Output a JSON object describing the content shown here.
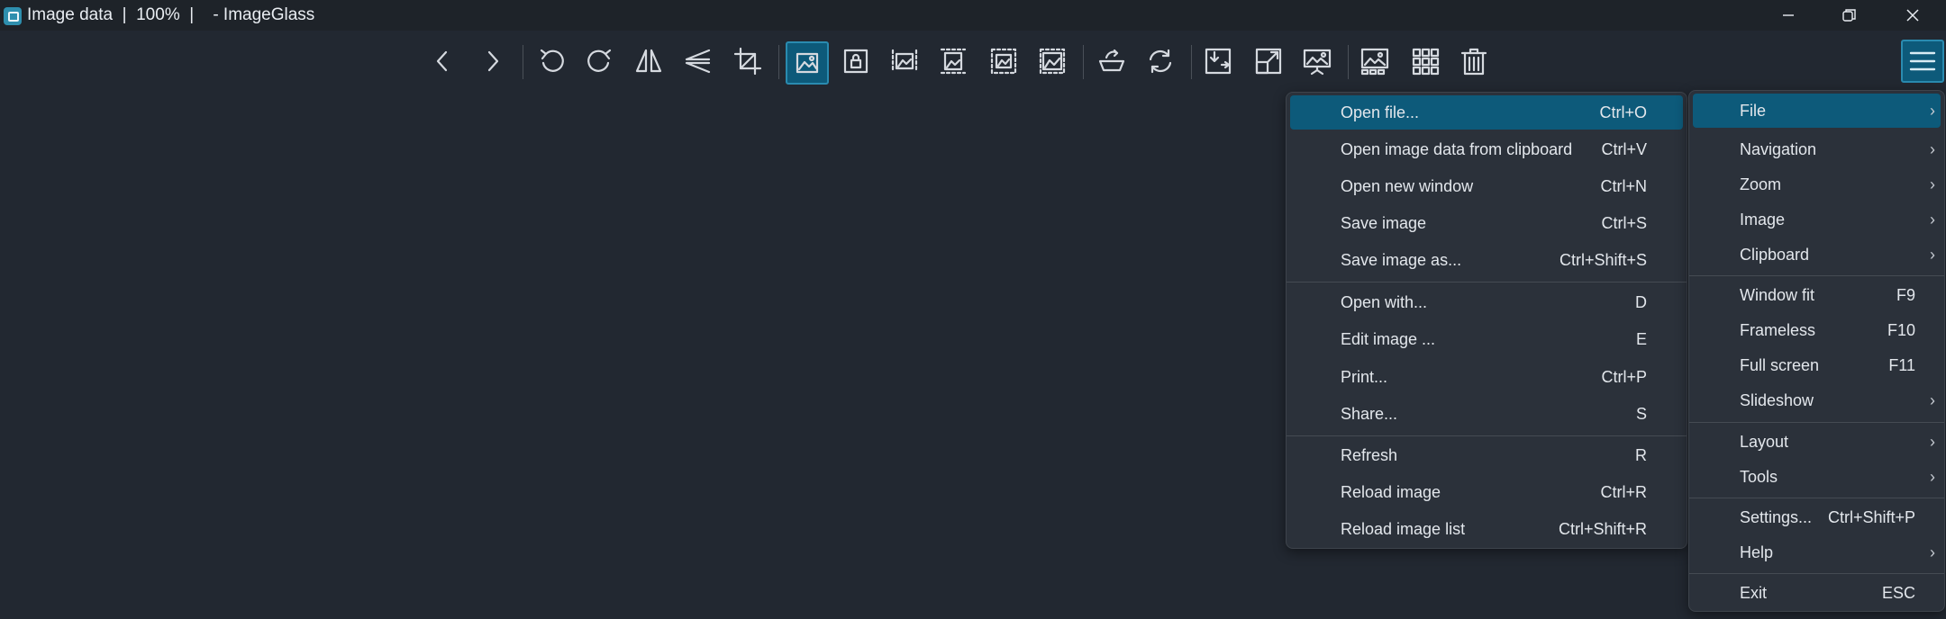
{
  "window": {
    "title": "Image data  |  100%  |    - ImageGlass",
    "minimize_label": "—",
    "maximize_label": "❐",
    "close_label": "✕"
  },
  "toolbar": {
    "buttons": [
      "previous-image",
      "next-image",
      "rotate-left",
      "rotate-right",
      "flip-horizontal",
      "flip-vertical",
      "crop",
      "auto-zoom",
      "lock-zoom",
      "scale-to-width",
      "scale-to-height",
      "scale-to-fit",
      "scale-to-fill",
      "open-with",
      "refresh",
      "checkerboard",
      "full-screen",
      "slideshow",
      "image-gallery",
      "thumbnail-bar",
      "delete"
    ],
    "active": "auto-zoom",
    "menu_button": "main-menu"
  },
  "file_menu": {
    "items": [
      {
        "label": "Open file...",
        "shortcut": "Ctrl+O"
      },
      {
        "label": "Open image data from clipboard",
        "shortcut": "Ctrl+V"
      },
      {
        "label": "Open new window",
        "shortcut": "Ctrl+N"
      },
      {
        "label": "Save image",
        "shortcut": "Ctrl+S"
      },
      {
        "label": "Save image as...",
        "shortcut": "Ctrl+Shift+S"
      },
      {
        "label": "Open with...",
        "shortcut": "D"
      },
      {
        "label": "Edit image ...",
        "shortcut": "E"
      },
      {
        "label": "Print...",
        "shortcut": "Ctrl+P"
      },
      {
        "label": "Share...",
        "shortcut": "S"
      },
      {
        "label": "Refresh",
        "shortcut": "R"
      },
      {
        "label": "Reload image",
        "shortcut": "Ctrl+R"
      },
      {
        "label": "Reload image list",
        "shortcut": "Ctrl+Shift+R"
      }
    ]
  },
  "main_menu": {
    "items": [
      {
        "label": "File",
        "shortcut": "",
        "arrow": "›"
      },
      {
        "label": "Navigation",
        "shortcut": "",
        "arrow": "›"
      },
      {
        "label": "Zoom",
        "shortcut": "",
        "arrow": "›"
      },
      {
        "label": "Image",
        "shortcut": "",
        "arrow": "›"
      },
      {
        "label": "Clipboard",
        "shortcut": "",
        "arrow": "›"
      },
      {
        "label": "Window fit",
        "shortcut": "F9",
        "arrow": ""
      },
      {
        "label": "Frameless",
        "shortcut": "F10",
        "arrow": ""
      },
      {
        "label": "Full screen",
        "shortcut": "F11",
        "arrow": ""
      },
      {
        "label": "Slideshow",
        "shortcut": "",
        "arrow": "›"
      },
      {
        "label": "Layout",
        "shortcut": "",
        "arrow": "›"
      },
      {
        "label": "Tools",
        "shortcut": "",
        "arrow": "›"
      },
      {
        "label": "Settings...",
        "shortcut": "Ctrl+Shift+P",
        "arrow": ""
      },
      {
        "label": "Help",
        "shortcut": "",
        "arrow": "›"
      },
      {
        "label": "Exit",
        "shortcut": "ESC",
        "arrow": ""
      }
    ]
  },
  "colors": {
    "background": "#222831",
    "accent": "#0d5a7a",
    "menu_bg": "#2b313a"
  }
}
